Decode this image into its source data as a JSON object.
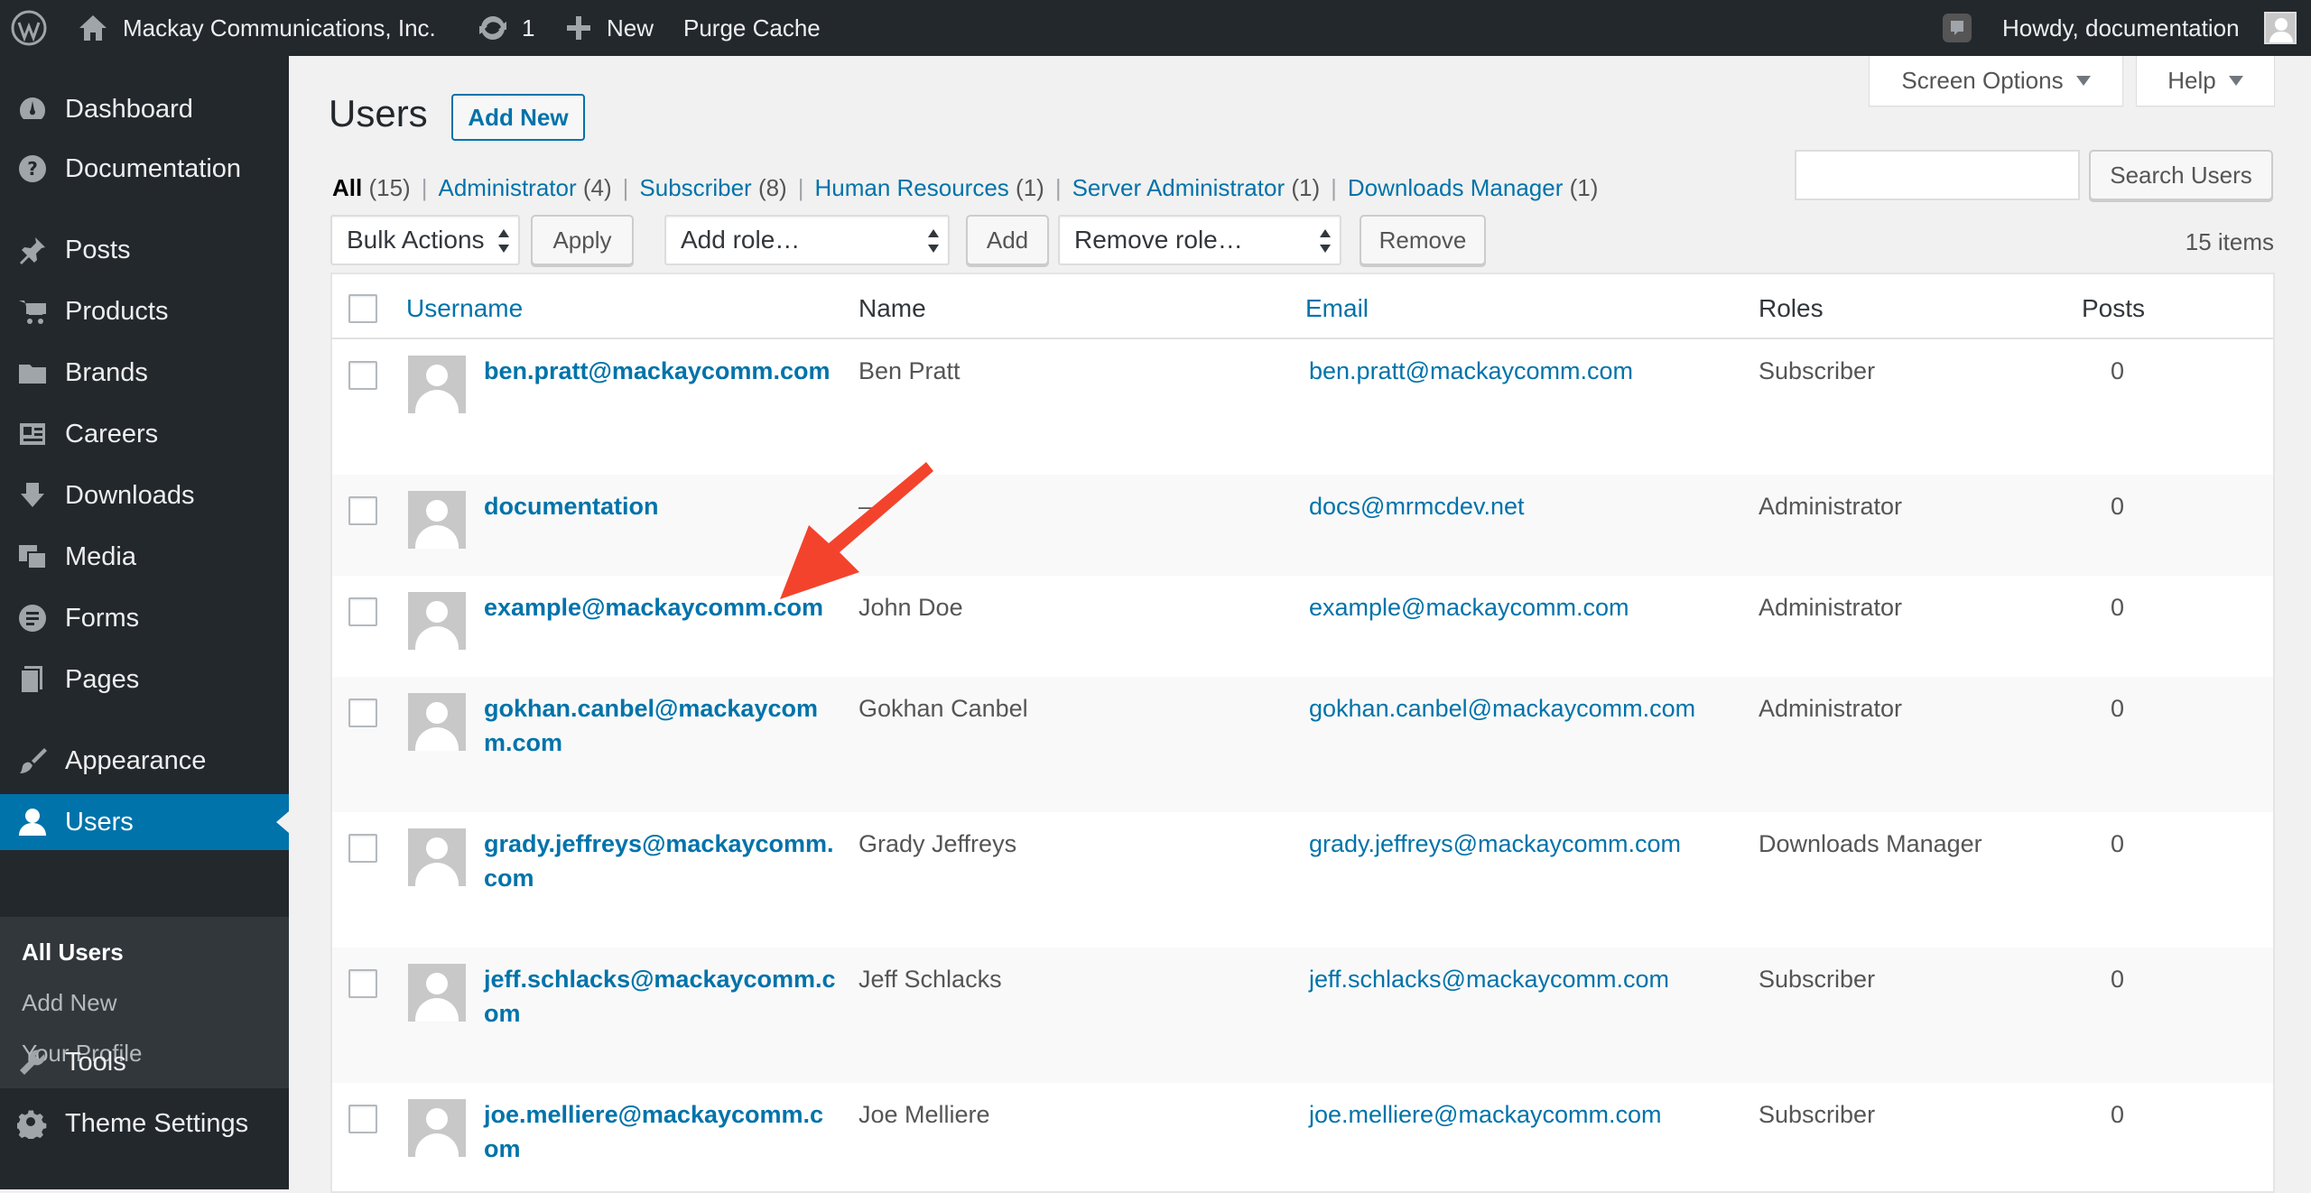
{
  "adminbar": {
    "site_name": "Mackay Communications, Inc.",
    "updates_count": "1",
    "new_label": "New",
    "purge_label": "Purge Cache",
    "howdy": "Howdy, documentation"
  },
  "sidebar": {
    "items": [
      {
        "label": "Dashboard",
        "icon": "dashboard-icon"
      },
      {
        "label": "Documentation",
        "icon": "question-icon"
      },
      {
        "label": "Posts",
        "icon": "pin-icon"
      },
      {
        "label": "Products",
        "icon": "cart-icon"
      },
      {
        "label": "Brands",
        "icon": "folder-icon"
      },
      {
        "label": "Careers",
        "icon": "id-card-icon"
      },
      {
        "label": "Downloads",
        "icon": "download-icon"
      },
      {
        "label": "Media",
        "icon": "media-icon"
      },
      {
        "label": "Forms",
        "icon": "forms-icon"
      },
      {
        "label": "Pages",
        "icon": "pages-icon"
      },
      {
        "label": "Appearance",
        "icon": "brush-icon"
      },
      {
        "label": "Users",
        "icon": "user-icon"
      },
      {
        "label": "Tools",
        "icon": "wrench-icon"
      },
      {
        "label": "Theme Settings",
        "icon": "gear-icon"
      }
    ],
    "submenu": [
      "All Users",
      "Add New",
      "Your Profile"
    ]
  },
  "screen_options": "Screen Options",
  "help": "Help",
  "page": {
    "title": "Users",
    "add_new": "Add New"
  },
  "views": [
    {
      "label": "All",
      "count": "(15)"
    },
    {
      "label": "Administrator",
      "count": "(4)"
    },
    {
      "label": "Subscriber",
      "count": "(8)"
    },
    {
      "label": "Human Resources",
      "count": "(1)"
    },
    {
      "label": "Server Administrator",
      "count": "(1)"
    },
    {
      "label": "Downloads Manager",
      "count": "(1)"
    }
  ],
  "search_button": "Search Users",
  "toolbar": {
    "bulk_actions": "Bulk Actions",
    "apply": "Apply",
    "add_role": "Add role…",
    "add": "Add",
    "remove_role": "Remove role…",
    "remove": "Remove",
    "items_count": "15 items"
  },
  "table": {
    "headers": [
      "Username",
      "Name",
      "Email",
      "Roles",
      "Posts"
    ],
    "rows": [
      {
        "username": "ben.pratt@mackaycomm.com",
        "name": "Ben Pratt",
        "email": "ben.pratt@mackaycomm.com",
        "role": "Subscriber",
        "posts": "0"
      },
      {
        "username": "documentation",
        "name": "—",
        "email": "docs@mrmcdev.net",
        "role": "Administrator",
        "posts": "0"
      },
      {
        "username": "example@mackaycomm.com",
        "name": "John Doe",
        "email": "example@mackaycomm.com",
        "role": "Administrator",
        "posts": "0"
      },
      {
        "username": "gokhan.canbel@mackaycomm.com",
        "name": "Gokhan Canbel",
        "email": "gokhan.canbel@mackaycomm.com",
        "role": "Administrator",
        "posts": "0"
      },
      {
        "username": "grady.jeffreys@mackaycomm.com",
        "name": "Grady Jeffreys",
        "email": "grady.jeffreys@mackaycomm.com",
        "role": "Downloads Manager",
        "posts": "0"
      },
      {
        "username": "jeff.schlacks@mackaycomm.com",
        "name": "Jeff Schlacks",
        "email": "jeff.schlacks@mackaycomm.com",
        "role": "Subscriber",
        "posts": "0"
      },
      {
        "username": "joe.melliere@mackaycomm.com",
        "name": "Joe Melliere",
        "email": "joe.melliere@mackaycomm.com",
        "role": "Subscriber",
        "posts": "0"
      }
    ]
  },
  "colors": {
    "accent": "#0073aa",
    "sidebar_bg": "#23282d",
    "annotation_arrow": "#f4432c"
  }
}
